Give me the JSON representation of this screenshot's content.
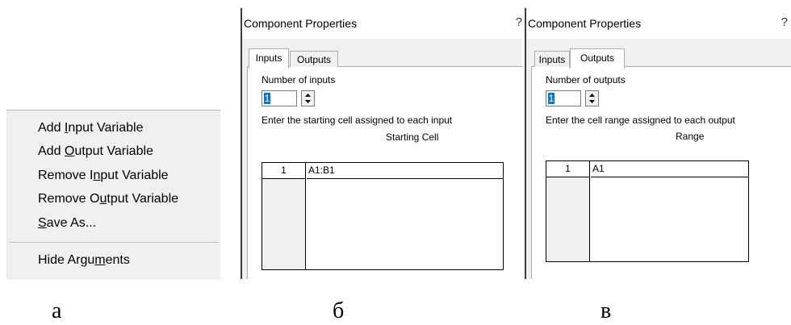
{
  "context_menu": {
    "items": [
      {
        "pre": "Add ",
        "key": "I",
        "post": "nput Variable"
      },
      {
        "pre": "Add ",
        "key": "O",
        "post": "utput Variable"
      },
      {
        "pre": "Remove I",
        "key": "n",
        "post": "put Variable"
      },
      {
        "pre": "Remove O",
        "key": "u",
        "post": "tput Variable"
      },
      {
        "pre": "",
        "key": "S",
        "post": "ave As..."
      },
      {
        "pre": "Hide Argu",
        "key": "m",
        "post": "ents"
      }
    ]
  },
  "dialog_inputs": {
    "title": "Component Properties",
    "help": "?",
    "tabs": [
      "Inputs",
      "Outputs"
    ],
    "active_tab": "Inputs",
    "count_label": "Number of inputs",
    "count_value": "1",
    "instruction": "Enter the starting cell assigned to each input",
    "column_header": "Starting Cell",
    "rows": [
      {
        "index": "1",
        "value": "A1:B1"
      }
    ]
  },
  "dialog_outputs": {
    "title": "Component Properties",
    "help": "?",
    "tabs": [
      "Inputs",
      "Outputs"
    ],
    "active_tab": "Outputs",
    "count_label": "Number of outputs",
    "count_value": "1",
    "instruction": "Enter the cell range assigned to each output",
    "column_header": "Range",
    "rows": [
      {
        "index": "1",
        "value": "A1"
      }
    ]
  },
  "captions": [
    "а",
    "б",
    "в"
  ]
}
